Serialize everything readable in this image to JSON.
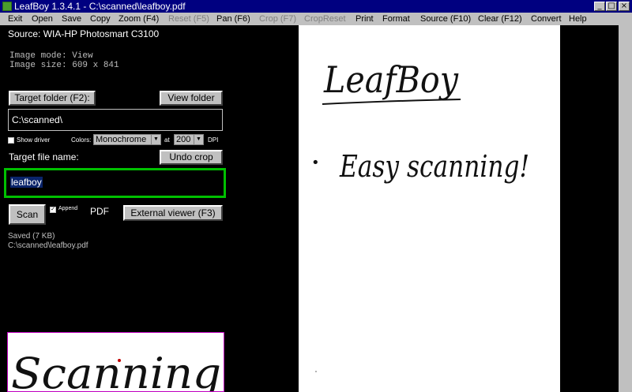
{
  "window": {
    "title": "LeafBoy 1.3.4.1 - C:\\scanned\\leafboy.pdf"
  },
  "window_buttons": {
    "minimize": "_",
    "maximize": "□",
    "close": "×"
  },
  "menu": [
    "Exit",
    "Open",
    "Save",
    "Copy",
    "Zoom (F4)",
    "Reset (F5)",
    "Pan (F6)",
    "Crop (F7)",
    "CropReset",
    "Print",
    "Format",
    "Source (F10)",
    "Clear (F12)",
    "Convert",
    "Help"
  ],
  "menu_disabled": [
    "Reset (F5)",
    "Crop (F7)",
    "CropReset"
  ],
  "source": {
    "label": "Source: WIA-HP Photosmart C3100"
  },
  "image_info": {
    "mode": "Image mode: View",
    "size": "Image size: 609 x 841"
  },
  "target_folder": {
    "button": "Target folder (F2):",
    "view_button": "View folder",
    "value": "C:\\scanned\\"
  },
  "options": {
    "show_driver_label": "Show driver",
    "colors_label": "Colors:",
    "colors_value": "Monochrome",
    "at_label": "at",
    "dpi_value": "200",
    "dpi_label": "DPI"
  },
  "target_file": {
    "label": "Target file name:",
    "undo_button": "Undo crop",
    "value": "leafboy"
  },
  "actions": {
    "scan": "Scan",
    "append_label": "Append",
    "format": "PDF",
    "external_viewer": "External viewer (F3)"
  },
  "status": {
    "saved": "Saved (7 KB)",
    "path": "C:\\scanned\\leafboy.pdf"
  },
  "document": {
    "heading": "LeafBoy",
    "bullet": "•",
    "line": "Easy scanning!"
  },
  "thumbnail": {
    "text": "Scanning"
  },
  "colors": {
    "title_bar": "#000080",
    "menu_bg": "#c0c0c0",
    "focus_border": "#00c000",
    "selection": "#0a246a",
    "thumb_border": "#c000c0"
  }
}
